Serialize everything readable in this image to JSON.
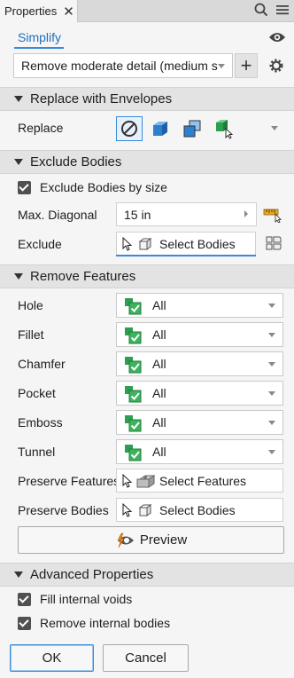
{
  "tab": {
    "title": "Properties"
  },
  "top": {
    "simplify_link": "Simplify",
    "preset_value": "Remove moderate detail (medium si"
  },
  "sections": {
    "replace": {
      "title": "Replace with Envelopes",
      "replace_label": "Replace"
    },
    "exclude": {
      "title": "Exclude Bodies",
      "checkbox_label": "Exclude Bodies by size",
      "max_diag_label": "Max. Diagonal",
      "max_diag_value": "15 in",
      "exclude_label": "Exclude",
      "exclude_select": "Select Bodies"
    },
    "remove": {
      "title": "Remove Features",
      "rows": [
        {
          "label": "Hole",
          "value": "All"
        },
        {
          "label": "Fillet",
          "value": "All"
        },
        {
          "label": "Chamfer",
          "value": "All"
        },
        {
          "label": "Pocket",
          "value": "All"
        },
        {
          "label": "Emboss",
          "value": "All"
        },
        {
          "label": "Tunnel",
          "value": "All"
        }
      ],
      "preserve_features_label": "Preserve Features",
      "preserve_features_select": "Select Features",
      "preserve_bodies_label": "Preserve Bodies",
      "preserve_bodies_select": "Select Bodies",
      "preview_label": "Preview"
    },
    "advanced": {
      "title": "Advanced Properties",
      "fill_voids": "Fill internal voids",
      "remove_bodies": "Remove internal bodies"
    }
  },
  "footer": {
    "ok": "OK",
    "cancel": "Cancel"
  },
  "colors": {
    "accent": "#1f6fbf",
    "feature_green": "#2e9e4f",
    "envelope_blue": "#2f7fd0"
  }
}
